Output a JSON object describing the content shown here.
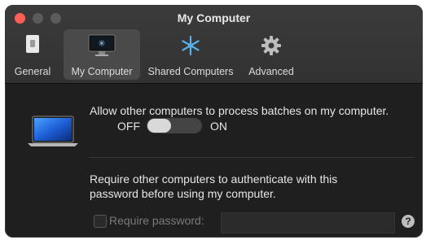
{
  "window": {
    "title": "My Computer"
  },
  "tabs": [
    {
      "label": "General"
    },
    {
      "label": "My Computer"
    },
    {
      "label": "Shared Computers"
    },
    {
      "label": "Advanced"
    }
  ],
  "allow": {
    "text": "Allow other computers to process batches on my computer.",
    "off_label": "OFF",
    "on_label": "ON"
  },
  "require": {
    "line1": "Require other computers to authenticate with this",
    "line2": "password before using my computer.",
    "checkbox_label": "Require password:",
    "password_value": "",
    "help_glyph": "?"
  }
}
